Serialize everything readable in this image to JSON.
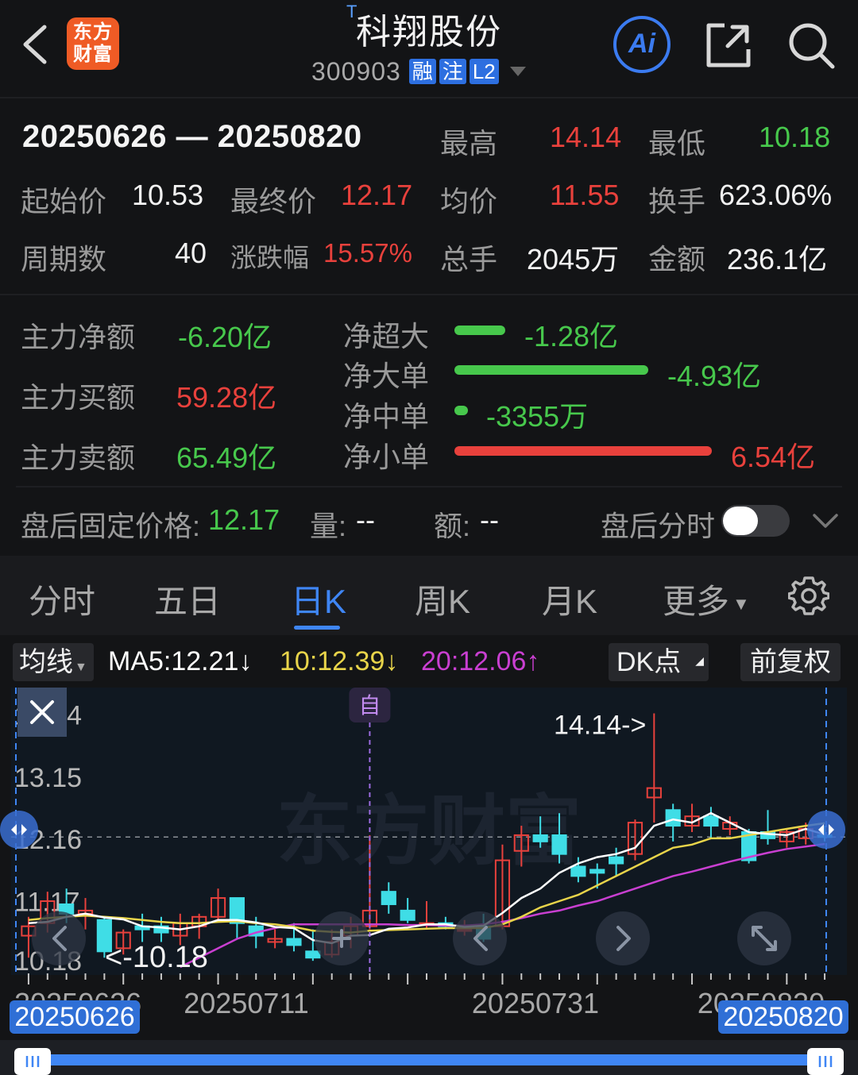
{
  "header": {
    "title": "科翔股份",
    "title_mark": "T",
    "code": "300903",
    "tags": [
      "融",
      "注",
      "L2"
    ],
    "logo_text": [
      "东方",
      "财富"
    ],
    "ai_label": "Ai"
  },
  "summary": {
    "date_range": "20250626 — 20250820",
    "high_label": "最高",
    "high": "14.14",
    "low_label": "最低",
    "low": "10.18",
    "open_label": "起始价",
    "open": "10.53",
    "close_label": "最终价",
    "close": "12.17",
    "avg_label": "均价",
    "avg": "11.55",
    "turnover_label": "换手",
    "turnover": "623.06%",
    "periods_label": "周期数",
    "periods": "40",
    "change_label": "涨跌幅",
    "change": "15.57%",
    "volume_label": "总手",
    "volume": "2045万",
    "amount_label": "金额",
    "amount": "236.1亿"
  },
  "fund_flow": {
    "net_main_label": "主力净额",
    "net_main": "-6.20亿",
    "main_buy_label": "主力买额",
    "main_buy": "59.28亿",
    "main_sell_label": "主力卖额",
    "main_sell": "65.49亿",
    "rows": [
      {
        "label": "净超大",
        "value": "-1.28亿",
        "ratio": 0.196,
        "color": "#47c84c"
      },
      {
        "label": "净大单",
        "value": "-4.93亿",
        "ratio": 0.754,
        "color": "#47c84c"
      },
      {
        "label": "净中单",
        "value": "-3355万",
        "ratio": 0.051,
        "color": "#47c84c"
      },
      {
        "label": "净小单",
        "value": "6.54亿",
        "ratio": 1.0,
        "color": "#e8413c"
      }
    ]
  },
  "after_hours": {
    "fixed_price_label": "盘后固定价格:",
    "fixed_price": "12.17",
    "volume_label": "量:",
    "volume": "--",
    "amount_label": "额:",
    "amount": "--",
    "timeshare_label": "盘后分时",
    "timeshare_on": false
  },
  "tabs": [
    "分时",
    "五日",
    "日K",
    "周K",
    "月K",
    "更多"
  ],
  "active_tab": "日K",
  "ma": {
    "selector": "均线",
    "ma5": "MA5:12.21",
    "ma10": "10:12.39",
    "ma20": "20:12.06",
    "dk_label": "DK点",
    "adjust_label": "前复权",
    "colors": {
      "ma5": "#ffffff",
      "ma10": "#e8d44a",
      "ma20": "#c93fd1"
    }
  },
  "chart_data": {
    "type": "candlestick",
    "ylim": [
      10.0,
      14.55
    ],
    "y_ticks": [
      "14.14",
      "13.15",
      "12.16",
      "11.17",
      "10.18"
    ],
    "x_ticks": [
      "20250626",
      "20250711",
      "20250731",
      "20250820"
    ],
    "high_annotation": "14.14->",
    "low_annotation": "<-10.18",
    "marker_label": "自",
    "reference_price": 12.17,
    "range_start": "20250626",
    "range_end": "20250820",
    "watermark": "东方财富",
    "candles": [
      {
        "o": 10.6,
        "h": 10.9,
        "l": 10.25,
        "c": 10.75
      },
      {
        "o": 10.8,
        "h": 11.3,
        "l": 10.65,
        "c": 11.15
      },
      {
        "o": 11.1,
        "h": 11.35,
        "l": 10.8,
        "c": 10.95
      },
      {
        "o": 10.95,
        "h": 11.2,
        "l": 10.7,
        "c": 11.0
      },
      {
        "o": 10.85,
        "h": 10.9,
        "l": 10.25,
        "c": 10.35
      },
      {
        "o": 10.4,
        "h": 10.7,
        "l": 10.3,
        "c": 10.65
      },
      {
        "o": 10.75,
        "h": 10.95,
        "l": 10.5,
        "c": 10.7
      },
      {
        "o": 10.75,
        "h": 10.9,
        "l": 10.5,
        "c": 10.65
      },
      {
        "o": 10.6,
        "h": 10.95,
        "l": 10.45,
        "c": 10.8
      },
      {
        "o": 10.75,
        "h": 10.95,
        "l": 10.55,
        "c": 10.9
      },
      {
        "o": 10.9,
        "h": 11.35,
        "l": 10.85,
        "c": 11.2
      },
      {
        "o": 11.2,
        "h": 11.2,
        "l": 10.55,
        "c": 10.8
      },
      {
        "o": 10.75,
        "h": 10.9,
        "l": 10.4,
        "c": 10.6
      },
      {
        "o": 10.5,
        "h": 10.7,
        "l": 10.4,
        "c": 10.55
      },
      {
        "o": 10.55,
        "h": 10.8,
        "l": 10.35,
        "c": 10.45
      },
      {
        "o": 10.35,
        "h": 10.7,
        "l": 10.2,
        "c": 10.25
      },
      {
        "o": 10.3,
        "h": 10.7,
        "l": 10.25,
        "c": 10.5
      },
      {
        "o": 10.6,
        "h": 10.9,
        "l": 10.4,
        "c": 10.75
      },
      {
        "o": 10.75,
        "h": 12.2,
        "l": 10.7,
        "c": 11.0
      },
      {
        "o": 11.3,
        "h": 11.45,
        "l": 10.95,
        "c": 11.1
      },
      {
        "o": 11.0,
        "h": 11.2,
        "l": 10.8,
        "c": 10.85
      },
      {
        "o": 10.8,
        "h": 11.15,
        "l": 10.7,
        "c": 10.8
      },
      {
        "o": 10.8,
        "h": 10.9,
        "l": 10.7,
        "c": 10.75
      },
      {
        "o": 10.7,
        "h": 10.85,
        "l": 10.6,
        "c": 10.7
      },
      {
        "o": 10.75,
        "h": 10.95,
        "l": 10.5,
        "c": 10.55
      },
      {
        "o": 10.75,
        "h": 12.05,
        "l": 10.7,
        "c": 11.8
      },
      {
        "o": 11.95,
        "h": 12.35,
        "l": 11.7,
        "c": 12.2
      },
      {
        "o": 12.2,
        "h": 12.5,
        "l": 12.0,
        "c": 12.1
      },
      {
        "o": 12.2,
        "h": 12.55,
        "l": 11.75,
        "c": 11.9
      },
      {
        "o": 11.7,
        "h": 11.85,
        "l": 11.45,
        "c": 11.55
      },
      {
        "o": 11.65,
        "h": 11.75,
        "l": 11.35,
        "c": 11.6
      },
      {
        "o": 11.85,
        "h": 12.0,
        "l": 11.55,
        "c": 11.75
      },
      {
        "o": 11.9,
        "h": 12.45,
        "l": 11.8,
        "c": 12.4
      },
      {
        "o": 12.8,
        "h": 14.14,
        "l": 12.4,
        "c": 12.95
      },
      {
        "o": 12.6,
        "h": 12.7,
        "l": 12.1,
        "c": 12.35
      },
      {
        "o": 12.35,
        "h": 12.7,
        "l": 12.25,
        "c": 12.5
      },
      {
        "o": 12.5,
        "h": 12.65,
        "l": 12.15,
        "c": 12.35
      },
      {
        "o": 12.3,
        "h": 12.5,
        "l": 12.2,
        "c": 12.4
      },
      {
        "o": 12.25,
        "h": 12.3,
        "l": 11.75,
        "c": 11.8
      },
      {
        "o": 12.25,
        "h": 12.6,
        "l": 12.05,
        "c": 12.15
      },
      {
        "o": 12.1,
        "h": 12.3,
        "l": 12.0,
        "c": 12.25
      },
      {
        "o": 12.15,
        "h": 12.4,
        "l": 12.05,
        "c": 12.3
      },
      {
        "o": 12.2,
        "h": 12.35,
        "l": 12.1,
        "c": 12.17
      }
    ],
    "ma5": [
      10.8,
      10.82,
      10.9,
      10.95,
      10.89,
      10.86,
      10.75,
      10.73,
      10.7,
      10.75,
      10.85,
      10.85,
      10.81,
      10.74,
      10.72,
      10.53,
      10.48,
      10.6,
      10.61,
      10.71,
      10.73,
      10.78,
      10.78,
      10.74,
      10.76,
      10.96,
      11.2,
      11.35,
      11.6,
      11.75,
      11.85,
      11.9,
      12.0,
      12.35,
      12.45,
      12.4,
      12.55,
      12.4,
      12.25,
      12.22,
      12.2,
      12.3,
      12.21
    ],
    "ma10": [
      10.85,
      10.88,
      10.9,
      10.92,
      10.9,
      10.88,
      10.85,
      10.82,
      10.8,
      10.8,
      10.82,
      10.83,
      10.8,
      10.78,
      10.74,
      10.68,
      10.66,
      10.65,
      10.68,
      10.69,
      10.7,
      10.71,
      10.72,
      10.72,
      10.72,
      10.78,
      10.9,
      11.05,
      11.15,
      11.25,
      11.4,
      11.55,
      11.7,
      11.85,
      12.0,
      12.05,
      12.15,
      12.15,
      12.2,
      12.25,
      12.3,
      12.35,
      12.39
    ],
    "ma20": [
      null,
      null,
      null,
      null,
      null,
      null,
      null,
      null,
      10.1,
      10.25,
      10.4,
      10.55,
      10.65,
      10.72,
      10.78,
      10.78,
      10.78,
      10.78,
      10.78,
      10.78,
      10.77,
      10.77,
      10.76,
      10.76,
      10.78,
      10.82,
      10.88,
      10.95,
      11.0,
      11.08,
      11.15,
      11.25,
      11.35,
      11.45,
      11.55,
      11.62,
      11.7,
      11.78,
      11.85,
      11.92,
      11.98,
      12.02,
      12.06
    ]
  }
}
